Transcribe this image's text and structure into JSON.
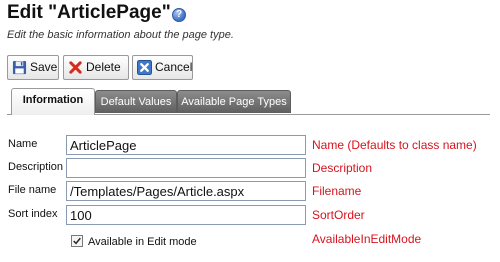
{
  "header": {
    "title": "Edit \"ArticlePage\"",
    "subtitle": "Edit the basic information about the page type."
  },
  "toolbar": {
    "save_label": "Save",
    "delete_label": "Delete",
    "cancel_label": "Cancel"
  },
  "tabs": [
    {
      "label": "Information",
      "active": true
    },
    {
      "label": "Default Values",
      "active": false
    },
    {
      "label": "Available Page Types",
      "active": false
    }
  ],
  "form": {
    "name": {
      "label": "Name",
      "value": "ArticlePage"
    },
    "description": {
      "label": "Description",
      "value": ""
    },
    "filename": {
      "label": "File name",
      "value": "/Templates/Pages/Article.aspx"
    },
    "sort_index": {
      "label": "Sort index",
      "value": "100"
    },
    "available_in_edit": {
      "label": "Available in Edit mode",
      "checked": true
    }
  },
  "annotations": {
    "name": "Name (Defaults to class name)",
    "description": "Description",
    "filename": "Filename",
    "sort_index": "SortOrder",
    "available": "AvailableInEditMode"
  },
  "colors": {
    "annotation": "#d6141e",
    "tab_inactive": "#6f6f6f",
    "input_border": "#8a9ab3"
  },
  "icons": {
    "help": "help-icon",
    "save": "floppy-disk-icon",
    "delete": "red-x-icon",
    "cancel": "blue-x-icon",
    "checkbox": "checkmark-icon"
  }
}
